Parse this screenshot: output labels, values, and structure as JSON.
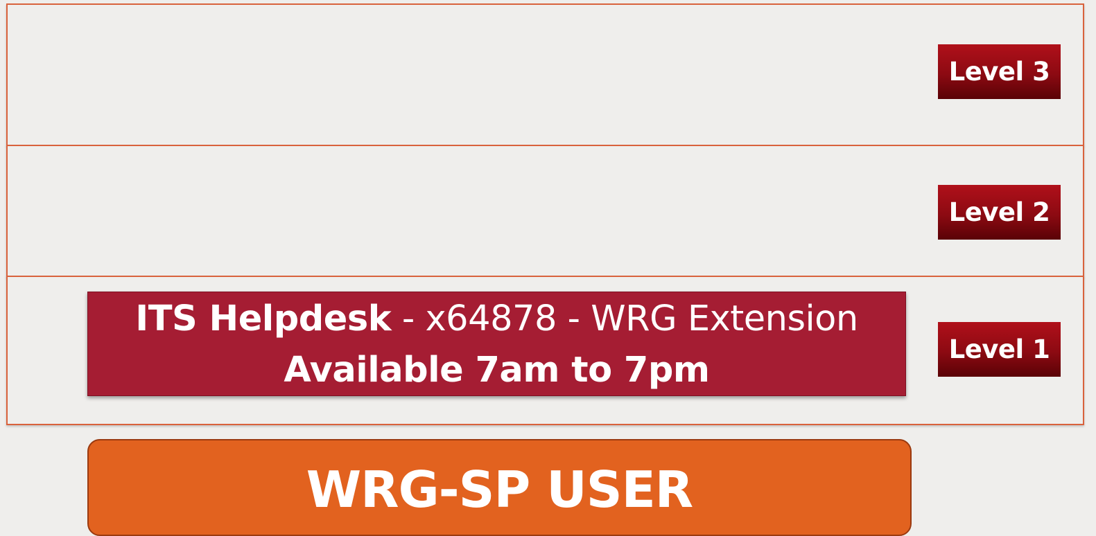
{
  "tiers": [
    {
      "level_label": "Level 3"
    },
    {
      "level_label": "Level 2"
    },
    {
      "level_label": "Level 1"
    }
  ],
  "helpdesk": {
    "name": "ITS Helpdesk",
    "separator1": " - ",
    "extension": "x64878",
    "separator2": " - ",
    "extension_label": "WRG Extension",
    "availability": "Available 7am to 7pm"
  },
  "user": {
    "label": "WRG-SP USER"
  },
  "colors": {
    "tier_border": "#d9623c",
    "level_badge": "#8c0a12",
    "helpdesk_box": "#a51d33",
    "user_box": "#e2621f",
    "background": "#efeeec"
  }
}
